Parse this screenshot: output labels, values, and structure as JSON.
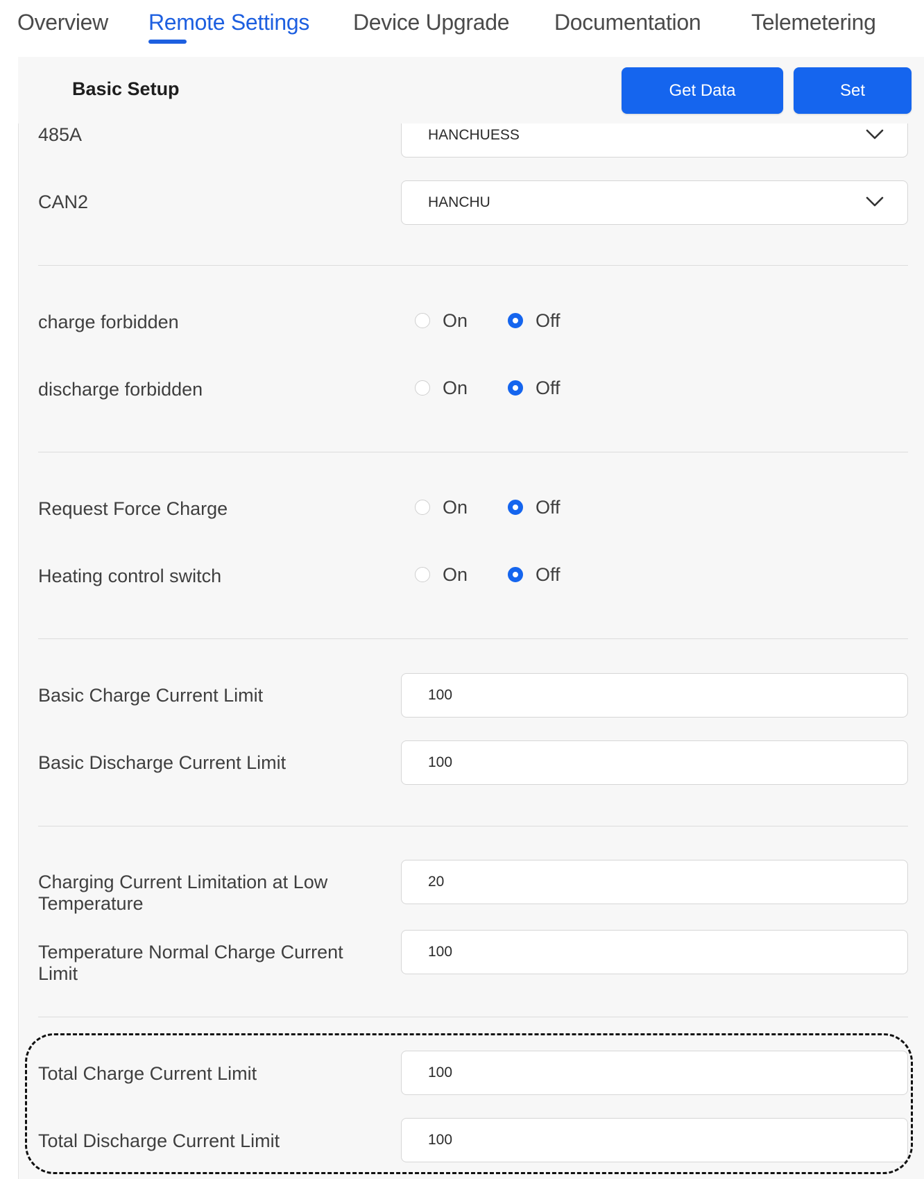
{
  "tabs": [
    {
      "label": "Overview"
    },
    {
      "label": "Remote Settings",
      "active": true
    },
    {
      "label": "Device Upgrade"
    },
    {
      "label": "Documentation"
    },
    {
      "label": "Telemetering"
    }
  ],
  "panel": {
    "title": "Basic Setup",
    "get_data_label": "Get Data",
    "set_label": "Set"
  },
  "selects": [
    {
      "label": "485A",
      "value": "HANCHUESS"
    },
    {
      "label": "CAN2",
      "value": "HANCHU"
    }
  ],
  "radios": [
    {
      "label": "charge forbidden",
      "on_label": "On",
      "off_label": "Off",
      "selected": "Off"
    },
    {
      "label": "discharge forbidden",
      "on_label": "On",
      "off_label": "Off",
      "selected": "Off"
    },
    {
      "label": "Request Force Charge",
      "on_label": "On",
      "off_label": "Off",
      "selected": "Off"
    },
    {
      "label": "Heating control switch",
      "on_label": "On",
      "off_label": "Off",
      "selected": "Off"
    }
  ],
  "inputs": [
    {
      "label": "Basic Charge Current Limit",
      "value": "100"
    },
    {
      "label": "Basic Discharge Current Limit",
      "value": "100"
    },
    {
      "label": "Charging Current Limitation at Low Temperature",
      "value": "20"
    },
    {
      "label": "Temperature Normal Charge Current Limit",
      "value": "100"
    },
    {
      "label": "Total Charge Current Limit",
      "value": "100"
    },
    {
      "label": "Total Discharge Current Limit",
      "value": "100"
    }
  ],
  "colors": {
    "accent": "#1565ee",
    "panel_bg": "#f7f7f7",
    "highlight_border": "#111111"
  },
  "icons": {
    "select_arrow": "chevron-down-icon"
  }
}
